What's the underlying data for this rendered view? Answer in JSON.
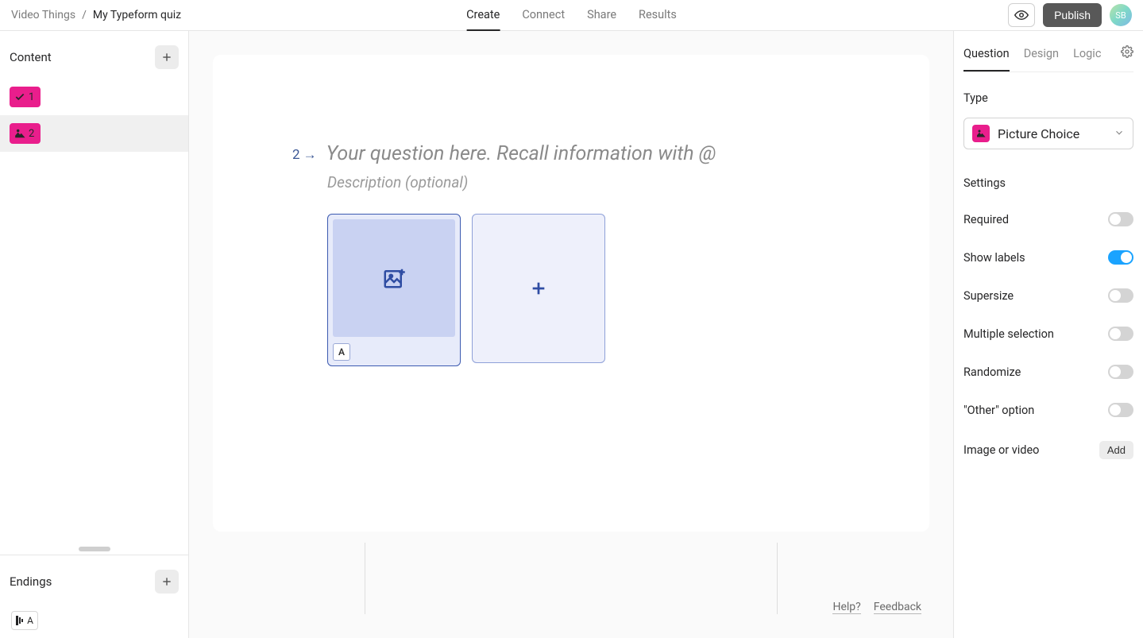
{
  "breadcrumb": {
    "workspace": "Video Things",
    "sep": "/",
    "form": "My Typeform quiz"
  },
  "topnav": {
    "create": "Create",
    "connect": "Connect",
    "share": "Share",
    "results": "Results"
  },
  "top_actions": {
    "publish": "Publish",
    "avatar_initials": "SB"
  },
  "sidebar": {
    "content_label": "Content",
    "endings_label": "Endings",
    "items": [
      {
        "num": "1"
      },
      {
        "num": "2"
      }
    ],
    "ending_letter": "A"
  },
  "canvas": {
    "q_number": "2",
    "arrow": "→",
    "title_placeholder": "Your question here. Recall information with @",
    "desc_placeholder": "Description (optional)",
    "choice_letter": "A"
  },
  "rightpanel": {
    "tabs": {
      "question": "Question",
      "design": "Design",
      "logic": "Logic"
    },
    "type_label": "Type",
    "type_value": "Picture Choice",
    "settings_label": "Settings",
    "settings": {
      "required": "Required",
      "show_labels": "Show labels",
      "supersize": "Supersize",
      "multiple": "Multiple selection",
      "randomize": "Randomize",
      "other": "\"Other\" option",
      "image": "Image or video",
      "add": "Add"
    },
    "toggles": {
      "required": false,
      "show_labels": true,
      "supersize": false,
      "multiple": false,
      "randomize": false,
      "other": false
    }
  },
  "footer": {
    "help": "Help?",
    "feedback": "Feedback"
  }
}
